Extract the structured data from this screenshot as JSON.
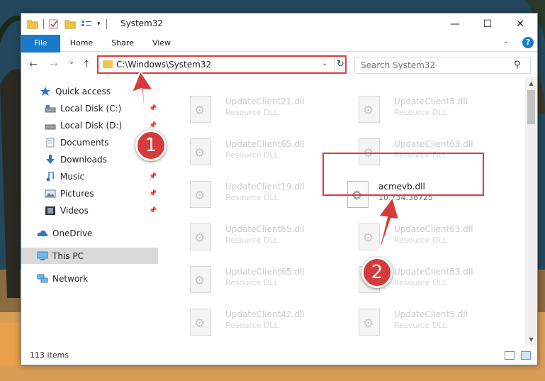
{
  "window": {
    "title": "System32",
    "controls": {
      "minimize": "—",
      "maximize": "☐",
      "close": "✕"
    }
  },
  "ribbon": {
    "tabs": [
      "File",
      "Home",
      "Share",
      "View"
    ],
    "expand_icon": "chevron-down-icon",
    "help": "?"
  },
  "nav": {
    "back": "←",
    "forward": "→",
    "recent": "⌄",
    "up": "↑",
    "address": "C:\\Windows\\System32",
    "dropdown": "⌄",
    "refresh": "↻",
    "search_placeholder": "Search System32",
    "search_icon": "⚲"
  },
  "sidebar": {
    "items": [
      {
        "label": "Quick access",
        "icon": "star-icon"
      },
      {
        "label": "Local Disk (C:)",
        "icon": "drive-icon",
        "pinned": true
      },
      {
        "label": "Local Disk (D:)",
        "icon": "drive-icon",
        "pinned": true
      },
      {
        "label": "Documents",
        "icon": "documents-icon",
        "pinned": true
      },
      {
        "label": "Downloads",
        "icon": "download-icon",
        "pinned": true
      },
      {
        "label": "Music",
        "icon": "music-icon",
        "pinned": true
      },
      {
        "label": "Pictures",
        "icon": "pictures-icon",
        "pinned": true
      },
      {
        "label": "Videos",
        "icon": "videos-icon",
        "pinned": true
      },
      {
        "label": "OneDrive",
        "icon": "cloud-icon"
      },
      {
        "label": "This PC",
        "icon": "computer-icon",
        "selected": true
      },
      {
        "label": "Network",
        "icon": "network-icon"
      }
    ],
    "pin_glyph": "📌"
  },
  "files": [
    {
      "name": "UpdateClient21.dll",
      "desc": "Resource DLL"
    },
    {
      "name": "UpdateClient5.dll",
      "desc": "Resource DLL"
    },
    {
      "name": "UpdateClient65.dll",
      "desc": "Resource DLL"
    },
    {
      "name": "UpdateClient63.dll",
      "desc": "Resource DLL"
    },
    {
      "name": "UpdateClient19.dll",
      "desc": "Resource DLL"
    },
    {
      "name": "acmevb.dll",
      "desc": "10.734.38725",
      "highlighted": true
    },
    {
      "name": "UpdateClient65.dll",
      "desc": "Resource DLL"
    },
    {
      "name": "UpdateClient63.dll",
      "desc": "Resource DLL"
    },
    {
      "name": "UpdateClient65.dll",
      "desc": "Resource DLL"
    },
    {
      "name": "UpdateClient63.dll",
      "desc": "Resource DLL"
    },
    {
      "name": "UpdateClient42.dll",
      "desc": "Resource DLL"
    },
    {
      "name": "UpdateClient5.dll",
      "desc": "Resource DLL"
    }
  ],
  "status": {
    "count": "113 items"
  },
  "annotations": {
    "step1": "1",
    "step2": "2",
    "color": "#d63b3b"
  }
}
